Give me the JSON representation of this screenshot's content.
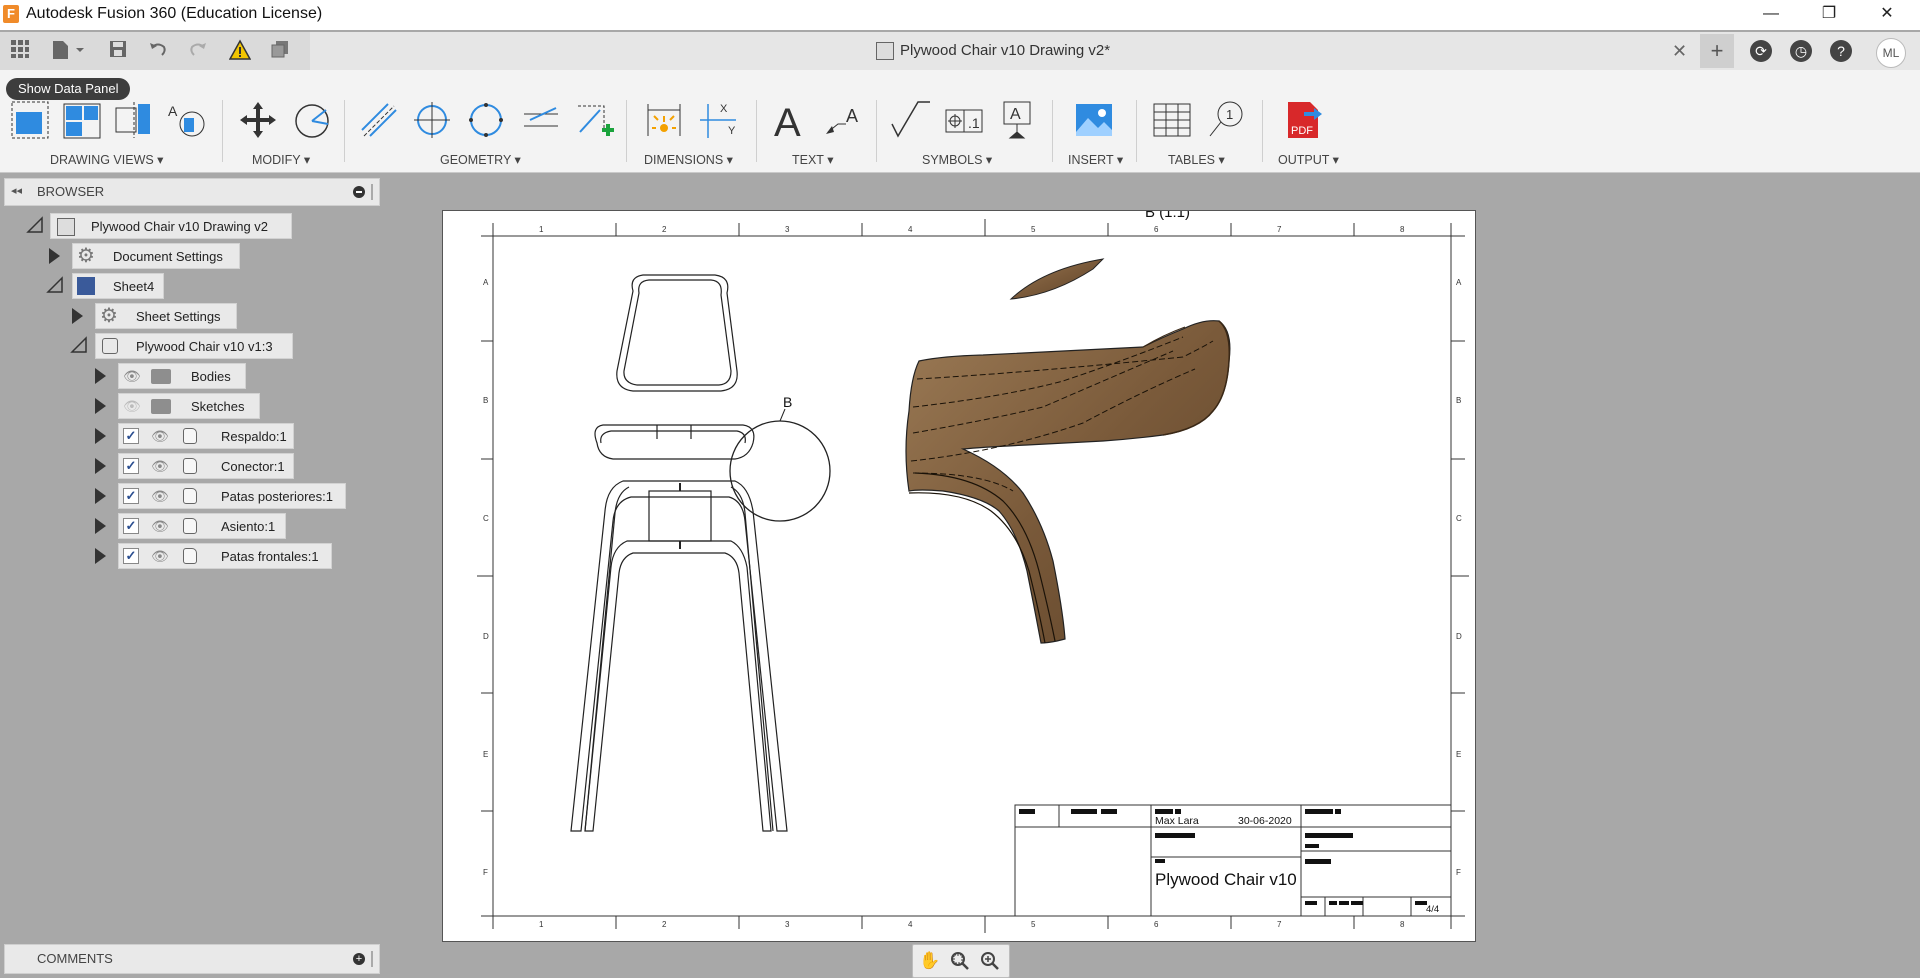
{
  "app": {
    "logo_letter": "F",
    "window_title": "Autodesk Fusion 360 (Education License)",
    "minimize": "—",
    "maximize": "❐",
    "close": "✕"
  },
  "document": {
    "title": "Plywood Chair v10 Drawing v2*",
    "close_symbol": "✕",
    "new_tab": "+",
    "user_initials": "ML"
  },
  "ribbon": {
    "tooltip": "Show Data Panel",
    "groups": {
      "drawing_views": "DRAWING VIEWS ▾",
      "modify": "MODIFY ▾",
      "geometry": "GEOMETRY ▾",
      "dimensions": "DIMENSIONS ▾",
      "text": "TEXT ▾",
      "symbols": "SYMBOLS ▾",
      "insert": "INSERT ▾",
      "tables": "TABLES ▾",
      "output": "OUTPUT ▾"
    },
    "pdf_label": "PDF"
  },
  "browser": {
    "title": "BROWSER",
    "collapse": "◂◂",
    "root": "Plywood Chair v10 Drawing v2",
    "document_settings": "Document Settings",
    "sheet": "Sheet4",
    "sheet_settings": "Sheet Settings",
    "component": "Plywood Chair v10 v1:3",
    "items": [
      {
        "label": "Bodies",
        "type": "folder",
        "checked": false,
        "visible": true
      },
      {
        "label": "Sketches",
        "type": "folder",
        "checked": false,
        "visible": false
      },
      {
        "label": "Respaldo:1",
        "type": "body",
        "checked": true,
        "visible": true
      },
      {
        "label": "Conector:1",
        "type": "body",
        "checked": true,
        "visible": true
      },
      {
        "label": "Patas posteriores:1",
        "type": "body",
        "checked": true,
        "visible": true
      },
      {
        "label": "Asiento:1",
        "type": "body",
        "checked": true,
        "visible": true
      },
      {
        "label": "Patas frontales:1",
        "type": "body",
        "checked": true,
        "visible": true
      }
    ]
  },
  "comments": {
    "title": "COMMENTS",
    "add": "+"
  },
  "drawing": {
    "detail_view_label": "B (1:1)",
    "detail_marker": "B",
    "zone_columns": [
      "1",
      "2",
      "3",
      "4",
      "5",
      "6",
      "7",
      "8"
    ],
    "zone_rows": [
      "A",
      "B",
      "C",
      "D",
      "E",
      "F"
    ],
    "title_block": {
      "author": "Max Lara",
      "date": "30-06-2020",
      "part_name": "Plywood Chair v10",
      "sheet_number": "4/4"
    }
  },
  "nav": {
    "pan": "✋",
    "zoom_window": "⚲",
    "zoom": "⚲"
  }
}
